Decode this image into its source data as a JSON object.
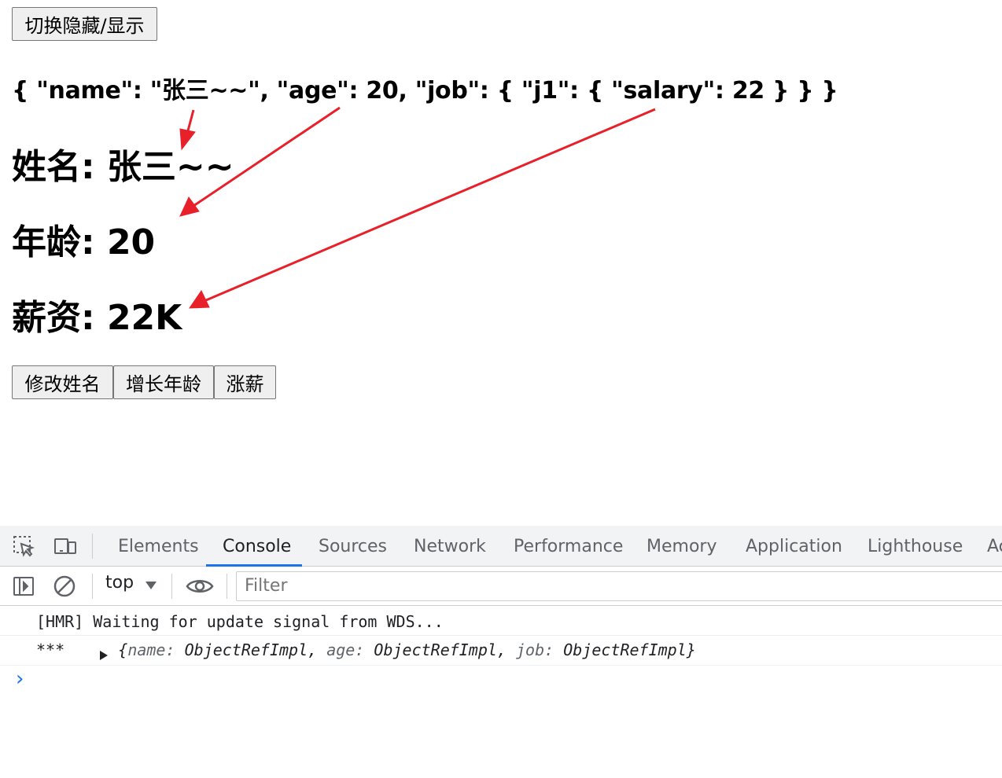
{
  "toggle_button": "切换隐藏/显示",
  "json_display": "{ \"name\": \"张三~~\", \"age\": 20, \"job\": { \"j1\": { \"salary\": 22 } } }",
  "person": {
    "name_label": "姓名:",
    "name_value": "张三~~",
    "age_label": "年龄:",
    "age_value": "20",
    "salary_label": "薪资:",
    "salary_value": "22K"
  },
  "actions": {
    "change_name": "修改姓名",
    "increase_age": "增长年龄",
    "raise_salary": "涨薪"
  },
  "annotation": {
    "arrow_color": "#e8202a"
  },
  "devtools": {
    "tabs": [
      "Elements",
      "Console",
      "Sources",
      "Network",
      "Performance",
      "Memory",
      "Application",
      "Lighthouse",
      "Ac"
    ],
    "active_tab": "Console",
    "context": "top",
    "filter_placeholder": "Filter",
    "accent_color": "#1a73e8",
    "console": {
      "line1": "[HMR] Waiting for update signal from WDS...",
      "line2_prefix": "***",
      "line2_open": "{",
      "k_name": "name:",
      "v_name": " ObjectRefImpl, ",
      "k_age": "age:",
      "v_age": " ObjectRefImpl, ",
      "k_job": "job:",
      "v_job": " ObjectRefImpl",
      "line2_close": "}",
      "prompt": "›"
    }
  }
}
